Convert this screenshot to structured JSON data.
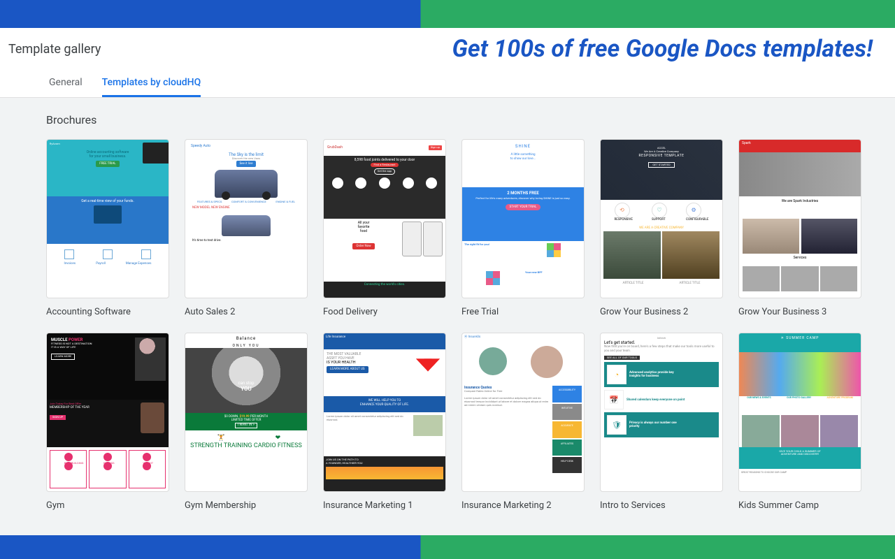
{
  "banner": {
    "promo_text": "Get 100s of free Google Docs templates!"
  },
  "gallery_title": "Template gallery",
  "tabs": {
    "general": "General",
    "cloudhq": "Templates by cloudHQ"
  },
  "section_title": "Brochures",
  "templates": [
    {
      "caption": "Accounting Software",
      "t1": {
        "brand": "flyAcorn",
        "tag1": "Online accounting software",
        "tag2": "for your small business.",
        "btn": "FREE TRIAL",
        "mid": "Get a real-time view of your funds.",
        "foot_labels": [
          "Invoices",
          "Payroll",
          "Manage Expenses"
        ]
      }
    },
    {
      "caption": "Auto Sales 2",
      "t2": {
        "brand": "Speedy Auto",
        "h1": "The Sky is the limit",
        "h2": "Discover the new Vans",
        "btn": "See it live",
        "cols": [
          "FEATURES & SPECS",
          "COMFORT & CONVENIENCE",
          "ENGINE & FUEL"
        ],
        "nm": "NEW MODEL NEW ENGINE",
        "td": "It's time to test drive."
      }
    },
    {
      "caption": "Food Delivery",
      "t3": {
        "brand": "GrubDash",
        "signup": "Sign up",
        "hero": "8,598 food joints delivered to your door",
        "btn1": "Find a Restaurant",
        "btn2": "Get the app",
        "h2a": "All your",
        "h2b": "favorite",
        "h2c": "food",
        "order": "Order Now",
        "foot": "Connecting the world's cities."
      }
    },
    {
      "caption": "Free Trial",
      "t4": {
        "brand": "SHINE",
        "sub1": "A little something",
        "sub2": "to show our love...",
        "mid_h": "2 MONTHS FREE",
        "mid_s": "Perfect for life's many adventures, discover why loving SHINE is just so easy.",
        "cta": "START YOUR TRIAL",
        "bl1": "The right fit for you!",
        "bl2": "Your new BFF"
      }
    },
    {
      "caption": "Grow Your Business 2",
      "t5": {
        "brand": "ACCEL",
        "sub": "We Are A Creative Company",
        "h": "RESPONSIVE TEMPLATE",
        "btn": "GET STARTED",
        "labels": [
          "RESPONSIVE",
          "SUPPORT",
          "CONFIGURABLE"
        ],
        "mid": "WE ARE A CREATIVE COMPANY",
        "art": "ARTICLE TITLE"
      }
    },
    {
      "caption": "Grow Your Business 3",
      "t6": {
        "brand": "Spark",
        "h": "We are Spark Industries",
        "sv": "Services"
      }
    },
    {
      "caption": "Gym",
      "t7": {
        "h1a": "MUSCLE ",
        "h1b": "POWER",
        "s1": "FITNESS IS NOT A DESTINATION",
        "s2": "IT IS A WAY OF LIFE",
        "lm": "LEARN MORE",
        "jt": "Join Today For Best Offer",
        "mo": "MEMBERSHIP OF THE YEAR",
        "su": "SIGN UP",
        "cats": [
          "BODYBUILDING",
          "FITNESS",
          "WEIGHT LIFT"
        ]
      }
    },
    {
      "caption": "Gym Membership",
      "t8": {
        "brand": "Balance",
        "ou": "ONLY YOU",
        "cs1": "can stop",
        "cs2": "YOU",
        "pr1": "$0 DOWN. ",
        "pr2": "$19.99 ",
        "pr3": "PER MONTH",
        "pr4": "LIMITED TIME OFFER",
        "btn": "I WANT IN >",
        "c1": "STRENGTH TRAINING",
        "c2": "CARDIO FITNESS"
      }
    },
    {
      "caption": "Insurance Marketing 1",
      "t9": {
        "brand": "Life Insurance",
        "h1": "THE MOST VALUABLE",
        "h2": "ASSET YOU HAVE",
        "h3": "IS YOUR HEALTH",
        "btn": "LEARN MORE ABOUT US",
        "bb1": "WE WILL HELP YOU TO",
        "bb2": "ENHANCE YOUR QUALITY OF LIFE.",
        "ft1": "JOIN US ON THE PATH TO",
        "ft2": "A YOUNGER, HEALTHIER YOU"
      }
    },
    {
      "caption": "Insurance Marketing 2",
      "t10": {
        "brand": "InsureUs",
        "h": "Insurance Quotes",
        "s": "Compare Rates Online for Free",
        "tags": [
          "ACCESSIBILITY",
          "INTUITIVE",
          "ACCURATE",
          "AFFILIATES",
          "HELP DESK"
        ],
        "colors": [
          "#2e82e4",
          "#8a8a8a",
          "#f7b733",
          "#1a8a6a",
          "#333"
        ]
      }
    },
    {
      "caption": "Intro to Services",
      "t11": {
        "brand": "Initech",
        "h": "Let's get started.",
        "btn": "SEE ALL OF OUR TOOLS",
        "r1a": "Advanced analytics provide key",
        "r1b": "insights for business",
        "r2": "Shared calendars keep everyone on point",
        "r3a": "Privacy is always our number one",
        "r3b": "priority"
      }
    },
    {
      "caption": "Kids Summer Camp",
      "t12": {
        "brand": "SUMMER CAMP",
        "c1": "OUR NEWS & EVENTS",
        "c2": "OUR PHOTO GALLERY",
        "c3": "ADVENTURE PROGRAM",
        "bb1": "GIVE YOUR CHILD A SUMMER OF",
        "bb2": "ADVENTURE AND DISCOVERY!",
        "ft": "GREAT REASONS TO CHOOSE OUR CAMP"
      }
    }
  ]
}
